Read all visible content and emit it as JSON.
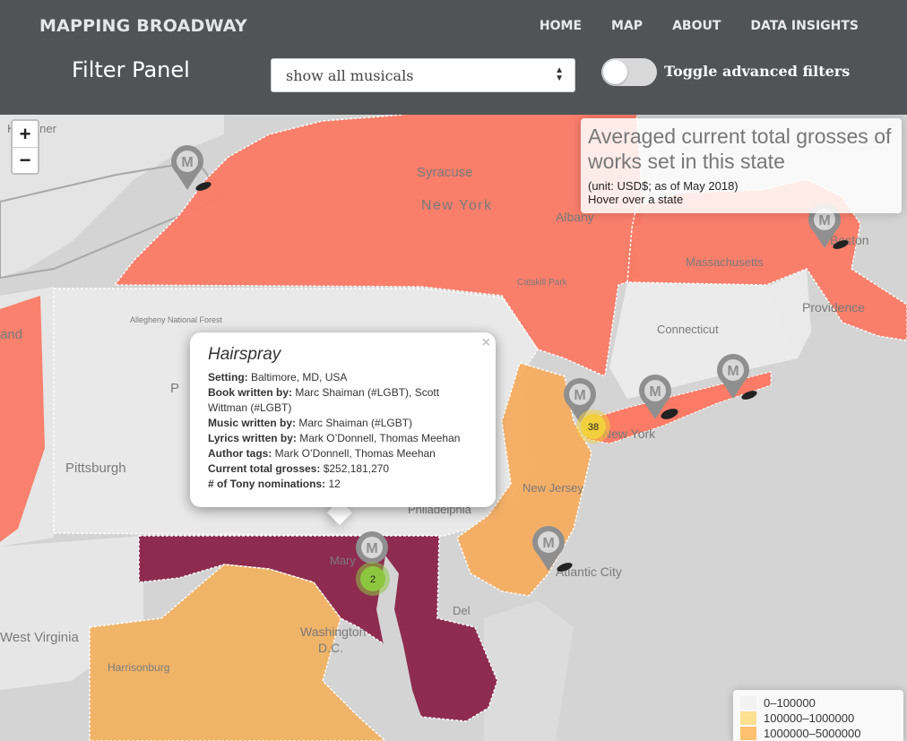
{
  "header": {
    "brand": "MAPPING BROADWAY",
    "nav": [
      "HOME",
      "MAP",
      "ABOUT",
      "DATA INSIGHTS"
    ],
    "filter_title": "Filter Panel",
    "select_value": "show all musicals",
    "toggle_label": "Toggle advanced filters",
    "toggle_on": false
  },
  "map": {
    "zoom_in": "+",
    "zoom_out": "−",
    "place_labels": {
      "kitchener": "Kitchener",
      "syracuse": "Syracuse",
      "new_york_state": "New York",
      "albany": "Albany",
      "boston": "Boston",
      "massachusetts": "Massachusetts",
      "catskill": "Catskill Park",
      "allegheny": "Allegheny National Forest",
      "providence": "Providence",
      "connecticut": "Connecticut",
      "cleveland": "and",
      "pittsburgh": "Pittsburgh",
      "pennsylvania": "P",
      "new_york_city": "New York",
      "new_jersey": "New Jersey",
      "philadelphia": "Philadelphia",
      "atlantic_city": "Atlantic City",
      "maryland": "Mary",
      "delaware": "Del",
      "washington": "Washington",
      "dc": "D.C.",
      "west_virginia": "West Virginia",
      "harrisonburg": "Harrisonburg"
    },
    "marker_label": "MUSICAL",
    "marker_letter": "M",
    "clusters": [
      {
        "count": "38",
        "color": "#f2d03c"
      },
      {
        "count": "2",
        "color": "#8cc63f"
      }
    ]
  },
  "info_box": {
    "title": "Averaged current total grosses of works set in this state",
    "unit": "(unit: USD$; as of May 2018)",
    "hint": "Hover over a state"
  },
  "popup": {
    "close": "×",
    "title": "Hairspray",
    "rows": [
      {
        "label": "Setting:",
        "value": " Baltimore, MD, USA"
      },
      {
        "label": "Book written by:",
        "value": " Marc Shaiman (#LGBT), Scott Wittman (#LGBT)"
      },
      {
        "label": "Music written by:",
        "value": " Marc Shaiman (#LGBT)"
      },
      {
        "label": "Lyrics written by:",
        "value": " Mark O’Donnell, Thomas Meehan"
      },
      {
        "label": "Author tags:",
        "value": " Mark O’Donnell, Thomas Meehan"
      },
      {
        "label": "Current total grosses:",
        "value": " $252,181,270"
      },
      {
        "label": "# of Tony nominations:",
        "value": " 12"
      }
    ]
  },
  "legend": {
    "items": [
      {
        "label": "0–100000",
        "color": "#f0f0f0"
      },
      {
        "label": "100000–1000000",
        "color": "#fed976"
      },
      {
        "label": "1000000–5000000",
        "color": "#feb24c"
      }
    ]
  },
  "colors": {
    "new_york": "#fb7b66",
    "new_jersey": "#f6ae62",
    "maryland": "#8e2c4f",
    "virginia": "#f2b363",
    "header_bg": "#515457"
  }
}
